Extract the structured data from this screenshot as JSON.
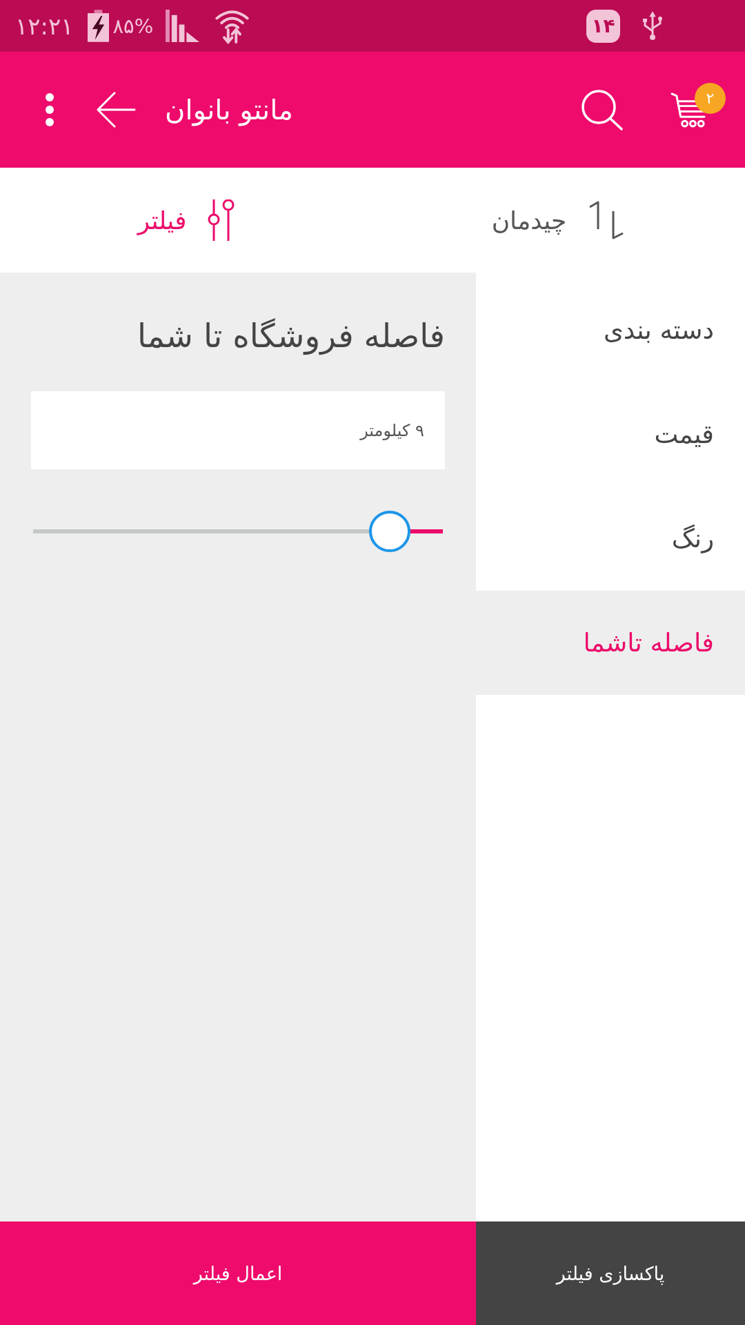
{
  "status_bar": {
    "time": "۱۲:۲۱",
    "battery": "۸۵%",
    "notification_count": "۱۴"
  },
  "app_bar": {
    "title": "مانتو بانوان",
    "cart_count": "۲"
  },
  "toolbar": [
    {
      "kind": "sort",
      "label": "چیدمان",
      "selected": false
    },
    {
      "kind": "filter",
      "label": "فیلتر",
      "selected": true
    }
  ],
  "sidebar": {
    "items": [
      {
        "label": "دسته بندی",
        "selected": false
      },
      {
        "label": "قیمت",
        "selected": false
      },
      {
        "label": "رنگ",
        "selected": false
      },
      {
        "label": "فاصله تاشما",
        "selected": true
      }
    ]
  },
  "panel": {
    "title": "فاصله فروشگاه تا شما",
    "distance_field": {
      "value": "۹ کیلومتر"
    },
    "slider": {
      "level": 0.13
    }
  },
  "buttons": [
    {
      "kind": "clear",
      "label": "پاکسازی فیلتر"
    },
    {
      "kind": "apply",
      "label": "اعمال فیلتر"
    }
  ]
}
